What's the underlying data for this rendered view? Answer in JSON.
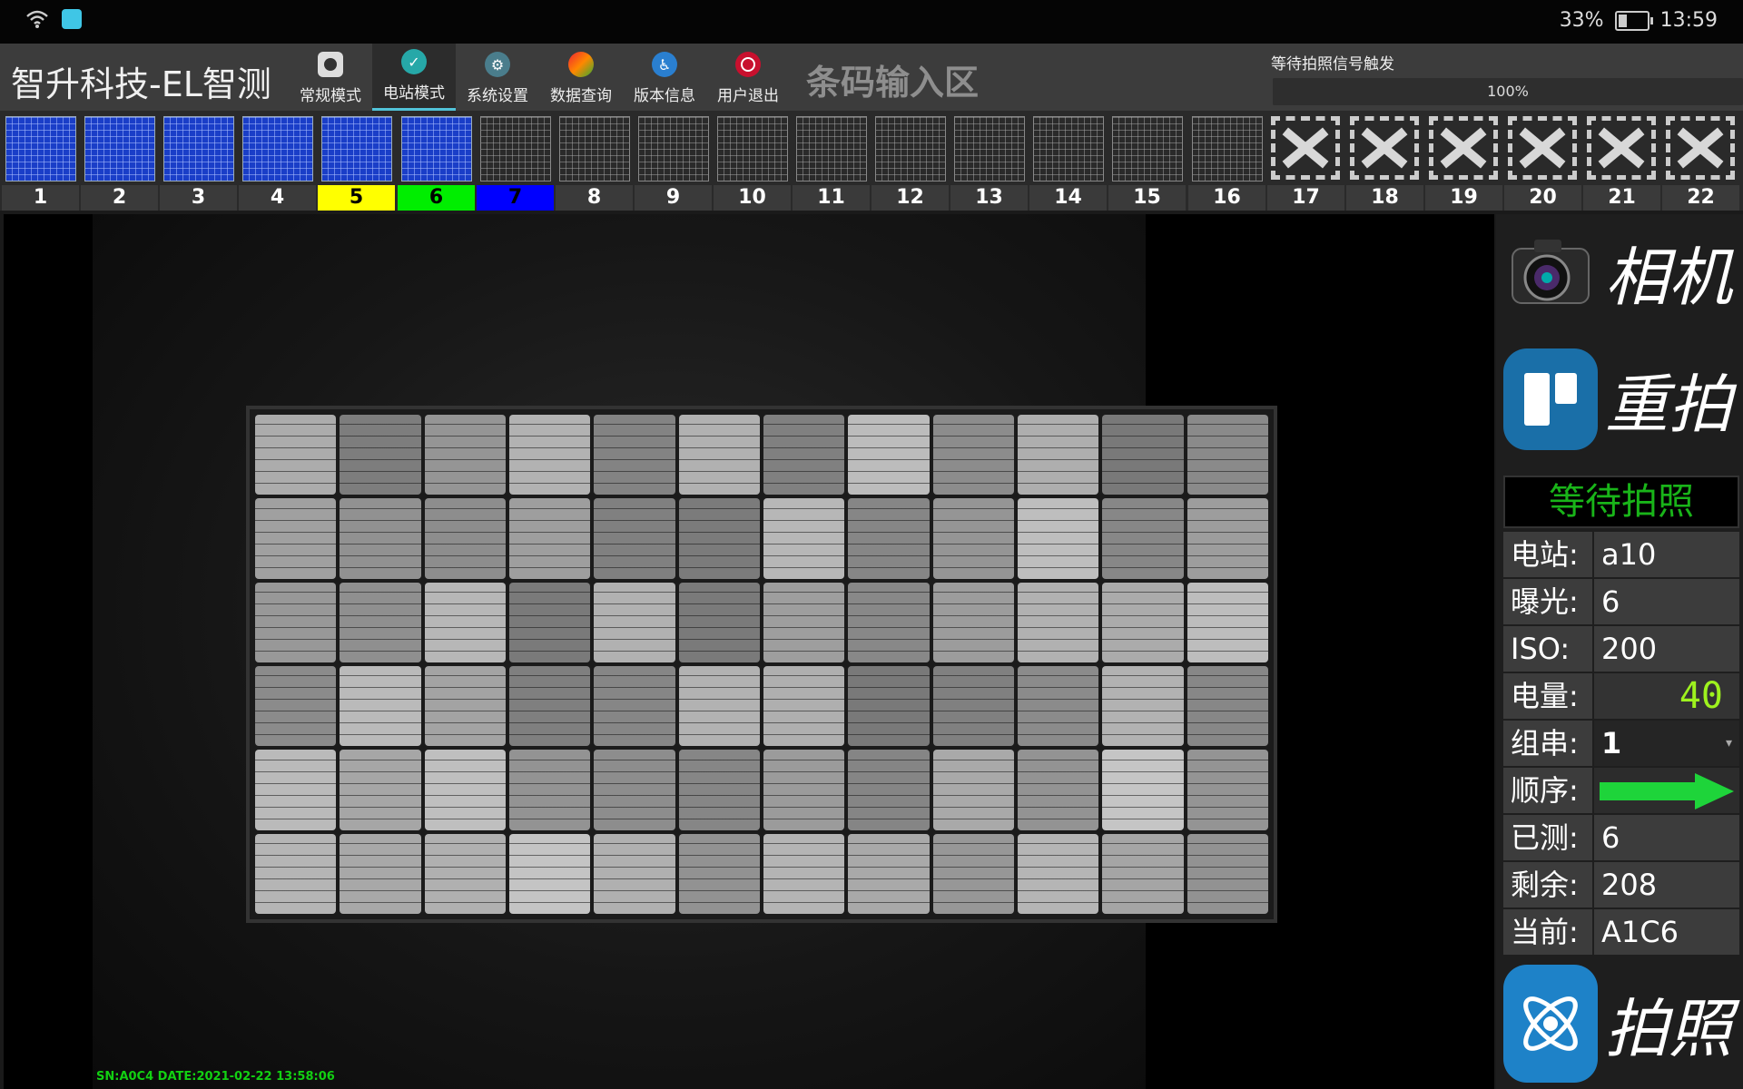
{
  "statusbar": {
    "battery_pct": "33%",
    "time": "13:59",
    "battery_level": 0.33
  },
  "header": {
    "brand": "智升科技-EL智测",
    "menu": [
      {
        "label": "常规模式",
        "icon": "camera-icon"
      },
      {
        "label": "电站模式",
        "icon": "shield-icon"
      },
      {
        "label": "系统设置",
        "icon": "gear-icon"
      },
      {
        "label": "数据查询",
        "icon": "chart-icon"
      },
      {
        "label": "版本信息",
        "icon": "accessibility-icon"
      },
      {
        "label": "用户退出",
        "icon": "power-icon"
      }
    ],
    "barcode_area": "条码输入区",
    "signal_text": "等待拍照信号触发",
    "progress_text": "100%",
    "progress_value": 1.0
  },
  "thumbnails": [
    {
      "num": "1",
      "state": "captured"
    },
    {
      "num": "2",
      "state": "captured"
    },
    {
      "num": "3",
      "state": "captured"
    },
    {
      "num": "4",
      "state": "captured"
    },
    {
      "num": "5",
      "state": "captured",
      "highlight": "yellow"
    },
    {
      "num": "6",
      "state": "captured",
      "highlight": "green"
    },
    {
      "num": "7",
      "state": "pending",
      "highlight": "blue"
    },
    {
      "num": "8",
      "state": "pending"
    },
    {
      "num": "9",
      "state": "pending"
    },
    {
      "num": "10",
      "state": "pending"
    },
    {
      "num": "11",
      "state": "pending"
    },
    {
      "num": "12",
      "state": "pending"
    },
    {
      "num": "13",
      "state": "pending"
    },
    {
      "num": "14",
      "state": "pending"
    },
    {
      "num": "15",
      "state": "pending"
    },
    {
      "num": "16",
      "state": "pending"
    },
    {
      "num": "17",
      "state": "empty"
    },
    {
      "num": "18",
      "state": "empty"
    },
    {
      "num": "19",
      "state": "empty"
    },
    {
      "num": "20",
      "state": "empty"
    },
    {
      "num": "21",
      "state": "empty"
    },
    {
      "num": "22",
      "state": "empty"
    }
  ],
  "viewer": {
    "stamp": "SN:A0C4   DATE:2021-02-22 13:58:06"
  },
  "side": {
    "camera_label": "相机",
    "retake_label": "重拍",
    "status": "等待拍照",
    "station_label": "电站:",
    "station_value": "a10",
    "exposure_label": "曝光:",
    "exposure_value": "6",
    "iso_label": "ISO:",
    "iso_value": "200",
    "power_label": "电量:",
    "power_value": "40",
    "string_label": "组串:",
    "string_value": "1",
    "order_label": "顺序:",
    "tested_label": "已测:",
    "tested_value": "6",
    "remaining_label": "剩余:",
    "remaining_value": "208",
    "current_label": "当前:",
    "current_value": "A1C6",
    "shoot_label": "拍照"
  },
  "colors": {
    "accent": "#52c3d8",
    "status_green": "#19b419",
    "lcd_green": "#9ef21e",
    "highlight_yellow": "#ffff00",
    "highlight_green": "#00ee00",
    "highlight_blue": "#0000ff"
  }
}
